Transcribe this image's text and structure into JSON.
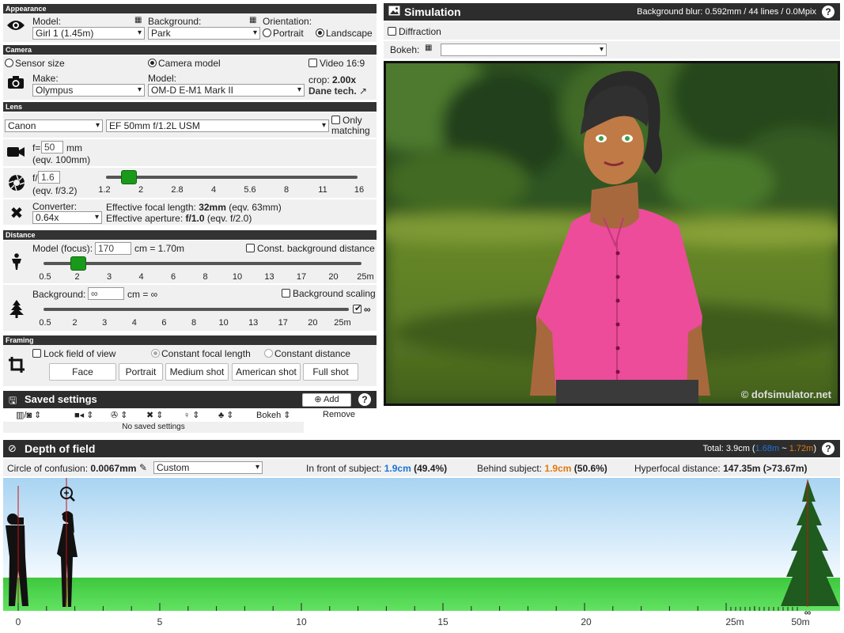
{
  "appearance": {
    "header": "Appearance",
    "model_label": "Model:",
    "model_value": "Girl 1 (1.45m)",
    "background_label": "Background:",
    "background_value": "Park",
    "orientation_label": "Orientation:",
    "portrait_label": "Portrait",
    "landscape_label": "Landscape"
  },
  "camera": {
    "header": "Camera",
    "sensor_size_label": "Sensor size",
    "camera_model_label": "Camera model",
    "video_label": "Video 16:9",
    "make_label": "Make:",
    "make_value": "Olympus",
    "model_label": "Model:",
    "model_value": "OM-D E-M1 Mark II",
    "crop_label": "crop:",
    "crop_value": "2.00x",
    "tech_link": "Dane tech."
  },
  "lens": {
    "header": "Lens",
    "brand_value": "Canon",
    "lens_value": "EF 50mm f/1.2L USM",
    "only_matching_line1": "Only",
    "only_matching_line2": "matching",
    "focal_prefix": "f=",
    "focal_value": "50",
    "focal_unit": "mm",
    "focal_eqv": "(eqv. 100mm)",
    "aperture_prefix": "f/",
    "aperture_value": "1.6",
    "aperture_eqv": "(eqv. f/3.2)",
    "aperture_ticks": [
      "1.2",
      "2",
      "2.8",
      "4",
      "5.6",
      "8",
      "11",
      "16"
    ],
    "aperture_position": 0.09,
    "converter_label": "Converter:",
    "converter_value": "0.64x",
    "eff_focal_label": "Effective focal length:",
    "eff_focal_value": "32mm",
    "eff_focal_eqv": "(eqv. 63mm)",
    "eff_aperture_label": "Effective aperture:",
    "eff_aperture_value": "f/1.0",
    "eff_aperture_eqv": "(eqv. f/2.0)"
  },
  "distance": {
    "header": "Distance",
    "model_focus_label": "Model (focus):",
    "model_focus_value": "170",
    "model_focus_result": "cm = 1.70m",
    "const_bg_label": "Const. background distance",
    "model_ticks": [
      "0.5",
      "2",
      "3",
      "4",
      "6",
      "8",
      "10",
      "13",
      "17",
      "20",
      "25m"
    ],
    "model_position": 0.11,
    "background_label": "Background:",
    "background_value": "∞",
    "background_result": "cm = ∞",
    "bg_scaling_label": "Background scaling",
    "infinity_label": "∞",
    "bg_ticks": [
      "0.5",
      "2",
      "3",
      "4",
      "6",
      "8",
      "10",
      "13",
      "17",
      "20",
      "25m"
    ]
  },
  "framing": {
    "header": "Framing",
    "lock_fov_label": "Lock field of view",
    "const_focal_label": "Constant focal length",
    "const_distance_label": "Constant distance",
    "buttons": [
      "Face",
      "Portrait",
      "Medium shot",
      "American shot",
      "Full shot"
    ]
  },
  "saved": {
    "title": "Saved settings",
    "add_label": "Add",
    "bokeh_col": "Bokeh",
    "remove_col": "Remove",
    "empty_text": "No saved settings"
  },
  "simulation": {
    "title": "Simulation",
    "blur_info": "Background blur: 0.592mm / 44 lines / 0.0Mpix",
    "diffraction_label": "Diffraction",
    "bokeh_label": "Bokeh:",
    "bokeh_value": "",
    "watermark": "© dofsimulator.net"
  },
  "dof": {
    "title": "Depth of field",
    "total_label": "Total:",
    "total_value": "3.9cm",
    "near_value": "1.68m",
    "tilde": "~",
    "far_value": "1.72m",
    "coc_label": "Circle of confusion:",
    "coc_value": "0.0067mm",
    "coc_select": "Custom",
    "front_label": "In front of subject:",
    "front_value": "1.9cm",
    "front_pct": "(49.4%)",
    "behind_label": "Behind subject:",
    "behind_value": "1.9cm",
    "behind_pct": "(50.6%)",
    "hyper_label": "Hyperfocal distance:",
    "hyper_value": "147.35m (>73.67m)",
    "axis_ticks": [
      "0",
      "5",
      "10",
      "15",
      "20",
      "25m",
      "50m"
    ],
    "infinity": "∞"
  },
  "colors": {
    "near": "#1e73d6",
    "far": "#e07a10",
    "slider": "#1a9a1a",
    "header": "#2d2d2d"
  }
}
